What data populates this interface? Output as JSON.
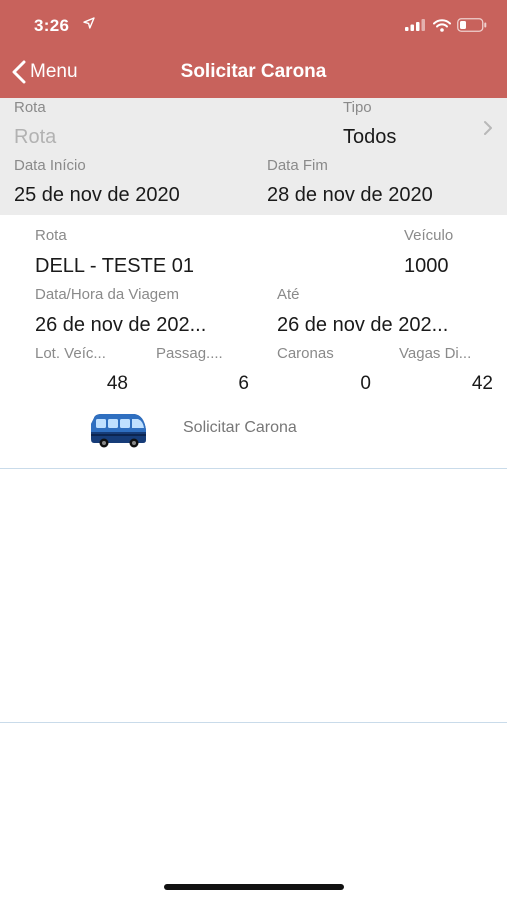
{
  "status_bar": {
    "time": "3:26"
  },
  "nav": {
    "back_label": "Menu",
    "title": "Solicitar Carona"
  },
  "filter": {
    "rota_label": "Rota",
    "rota_placeholder": "Rota",
    "tipo_label": "Tipo",
    "tipo_value": "Todos",
    "data_inicio_label": "Data Início",
    "data_inicio_value": "25 de nov de 2020",
    "data_fim_label": "Data Fim",
    "data_fim_value": "28 de nov de 2020"
  },
  "trip": {
    "rota_label": "Rota",
    "rota_value": "DELL - TESTE 01",
    "veiculo_label": "Veículo",
    "veiculo_value": "1000",
    "data_hora_label": "Data/Hora da Viagem",
    "data_hora_value": "26 de nov de 202...",
    "ate_label": "Até",
    "ate_value": "26 de nov de 202...",
    "lot_label": "Lot. Veíc...",
    "lot_value": "48",
    "passag_label": "Passag....",
    "passag_value": "6",
    "caronas_label": "Caronas",
    "caronas_value": "0",
    "vagas_label": "Vagas Di...",
    "vagas_value": "42",
    "request_label": "Solicitar Carona"
  },
  "icons": {
    "back": "chevron-left-icon",
    "disclosure": "chevron-right-icon",
    "bus": "bus-icon",
    "location": "location-arrow-icon",
    "signal": "cellular-signal-icon",
    "wifi": "wifi-icon",
    "battery": "battery-icon"
  },
  "colors": {
    "header": "#c8625c",
    "filter_bg": "#ececec",
    "separator": "#c9dbea"
  }
}
